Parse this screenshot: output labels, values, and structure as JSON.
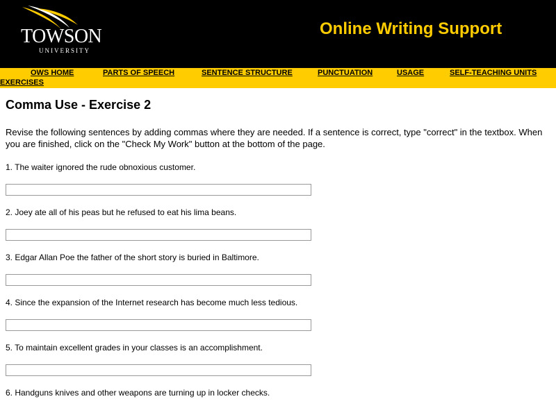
{
  "header": {
    "logo_name": "TOWSON",
    "logo_sub": "UNIVERSITY",
    "site_title": "Online Writing Support"
  },
  "nav": {
    "items": [
      {
        "label": "OWS HOME"
      },
      {
        "label": "PARTS OF SPEECH"
      },
      {
        "label": "SENTENCE STRUCTURE"
      },
      {
        "label": "PUNCTUATION"
      },
      {
        "label": "USAGE"
      },
      {
        "label": "SELF-TEACHING UNITS"
      },
      {
        "label": "EXERCISES"
      }
    ]
  },
  "page": {
    "title": "Comma Use - Exercise 2",
    "instructions": "Revise the following sentences by adding commas where they are needed. If a sentence is correct, type \"correct\" in the textbox. When you are finished, click on the \"Check My Work\" button at the bottom of the page."
  },
  "questions": [
    {
      "text": "1.  The waiter ignored the rude obnoxious customer.",
      "value": ""
    },
    {
      "text": "2.  Joey ate all of his peas but he refused to eat his lima beans.",
      "value": ""
    },
    {
      "text": "3.  Edgar Allan Poe the father of the short story is buried in Baltimore.",
      "value": ""
    },
    {
      "text": "4.  Since the expansion of the Internet research has become much less tedious.",
      "value": ""
    },
    {
      "text": "5.  To maintain excellent grades in your classes is an accomplishment.",
      "value": ""
    },
    {
      "text": "6.  Handguns knives and other weapons are turning up in locker checks.",
      "value": ""
    }
  ],
  "colors": {
    "header_bg": "#000000",
    "accent": "#ffcc00"
  }
}
